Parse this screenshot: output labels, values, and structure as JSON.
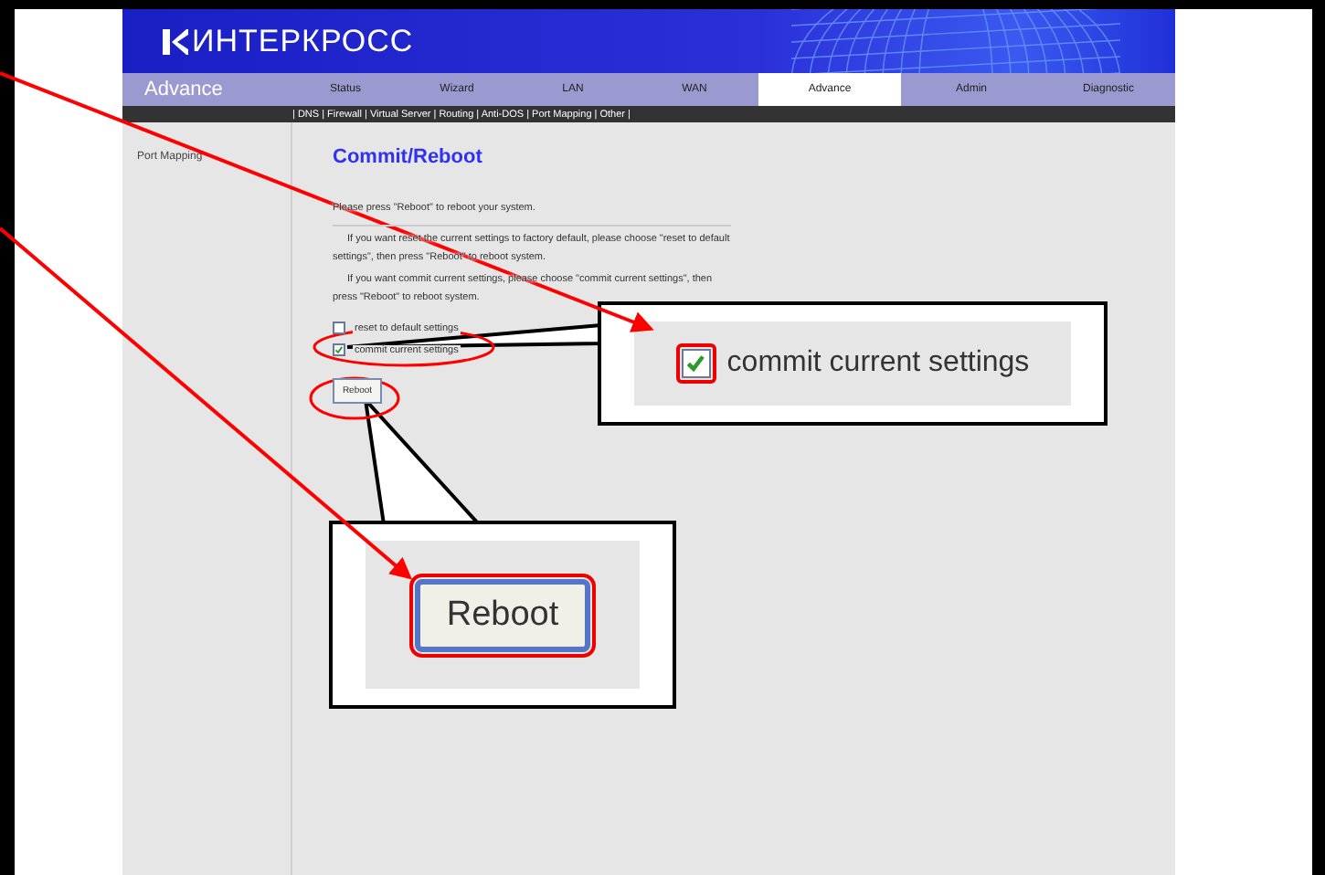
{
  "header": {
    "logo": "ИНТЕРКРОСС"
  },
  "section_title": "Advance",
  "tabs": [
    {
      "label": "Status",
      "selected": false
    },
    {
      "label": "Wizard",
      "selected": false
    },
    {
      "label": "LAN",
      "selected": false
    },
    {
      "label": "WAN",
      "selected": false
    },
    {
      "label": "Advance",
      "selected": true
    },
    {
      "label": "Admin",
      "selected": false
    },
    {
      "label": "Diagnostic",
      "selected": false
    }
  ],
  "subnav": "| DNS | Firewall | Virtual Server | Routing | Anti-DOS | Port Mapping | Other |",
  "sidebar": {
    "items": [
      "Port Mapping"
    ]
  },
  "page_title": "Commit/Reboot",
  "intro": "Please press \"Reboot\" to reboot your system.",
  "paragraphs": [
    "If you want reset the current settings to factory default, please choose \"reset to default settings\", then press \"Reboot\" to reboot system.",
    "If you want commit current settings, please choose \"commit current settings\", then press \"Reboot\" to reboot system."
  ],
  "options": [
    {
      "label": "reset to default settings",
      "checked": false
    },
    {
      "label": "commit current settings",
      "checked": true
    }
  ],
  "button": "Reboot",
  "callouts": [
    {
      "kind": "checkbox",
      "label": "commit current settings",
      "checked": true
    },
    {
      "kind": "button",
      "label": "Reboot"
    }
  ]
}
